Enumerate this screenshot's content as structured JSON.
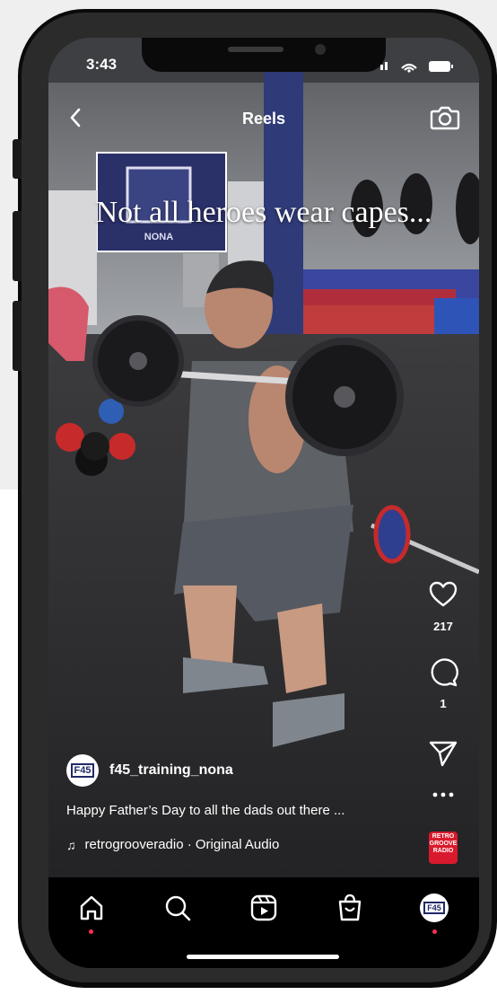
{
  "status_bar": {
    "time": "3:43"
  },
  "header": {
    "title": "Reels",
    "back_icon": "chevron-left-icon",
    "camera_icon": "camera-icon"
  },
  "video": {
    "overlay_text": "Not all heroes wear capes..."
  },
  "actions": {
    "like_count": "217",
    "comment_count": "1",
    "more_icon": "more-icon",
    "share_icon": "send-icon"
  },
  "author": {
    "username": "f45_training_nona",
    "avatar_text": "F45"
  },
  "caption": "Happy Father’s Day to all the dads out there ...",
  "audio": {
    "label": "retrogrooveradio · Original Audio",
    "thumb_text": "RETRO GROOVE RADIO"
  },
  "nav": {
    "items": [
      "home-icon",
      "search-icon",
      "reels-icon",
      "shop-icon",
      "profile-icon"
    ]
  },
  "colors": {
    "accent": "#ff2d55",
    "background": "#000000"
  }
}
